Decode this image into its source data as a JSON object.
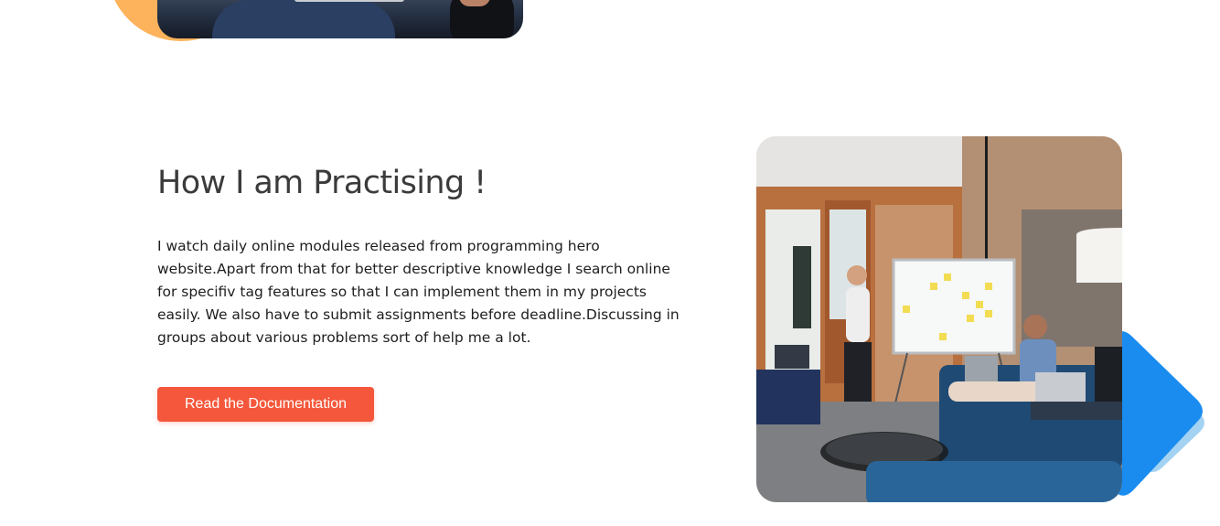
{
  "section": {
    "heading": "How I am Practising !",
    "body": "I watch daily online modules released from programming hero website.Apart from that for better descriptive knowledge I search online for specifiv tag features so that I can implement them in my projects easily. We also have to submit assignments before deadline.Discussing in groups about various problems sort of help me a lot.",
    "button_label": "Read the Documentation"
  },
  "colors": {
    "accent_button": "#f4573b",
    "heading_text": "#3b3b3b",
    "blob_orange": "#fdb25c",
    "blob_blue": "#1a8cf0"
  },
  "images": {
    "top_image": "person-with-laptop-photo",
    "practice_image": "team-meeting-whiteboard-photo"
  }
}
